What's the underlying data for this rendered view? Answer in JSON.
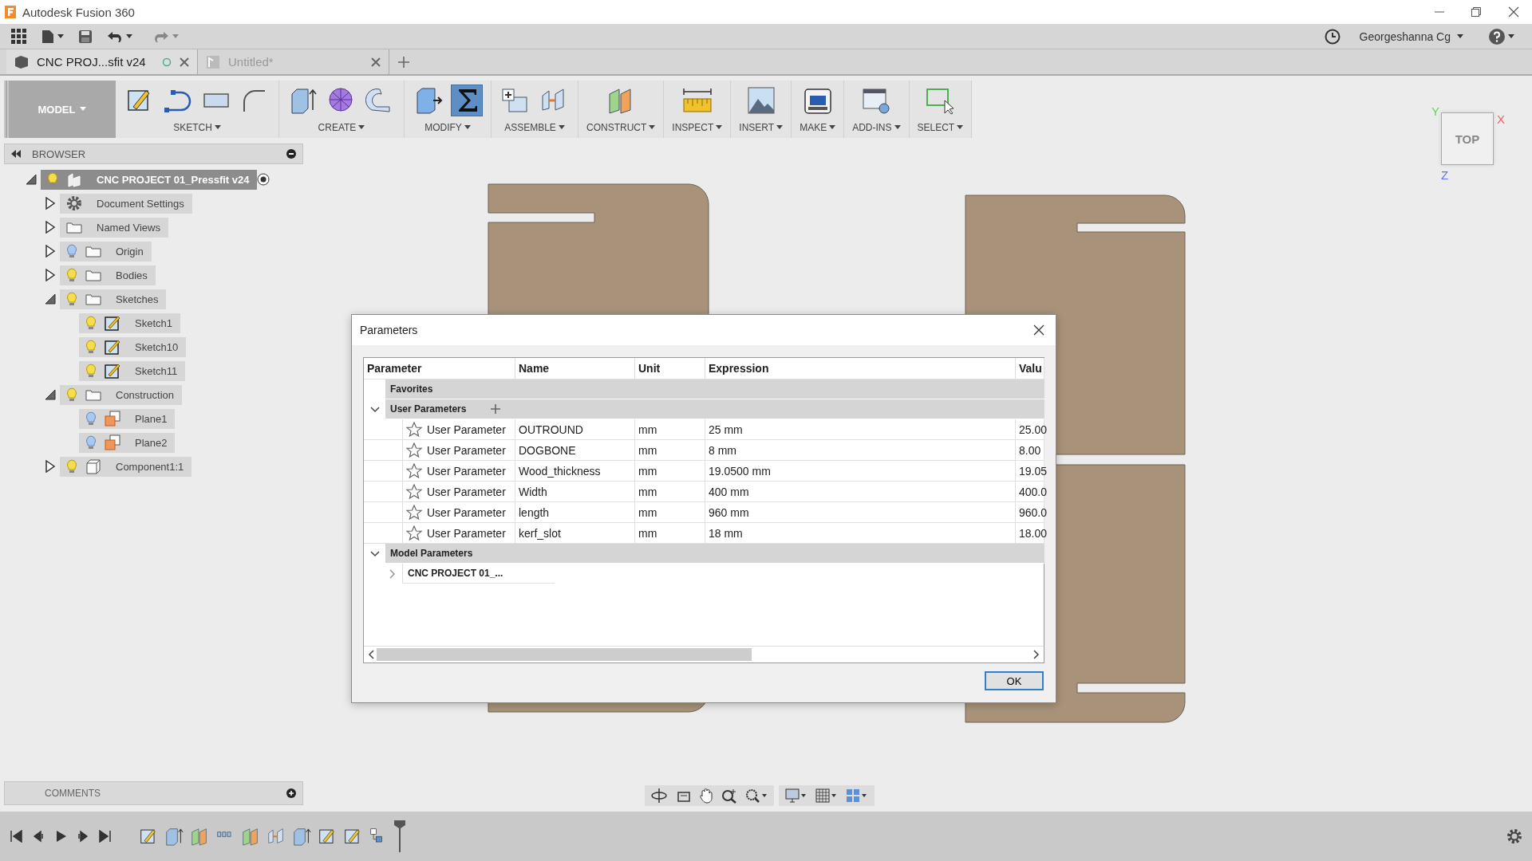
{
  "window": {
    "title": "Autodesk Fusion 360"
  },
  "account": {
    "user": "Georgeshanna Cg"
  },
  "tabs": [
    {
      "label": "CNC PROJ...sfit v24",
      "selected": true
    },
    {
      "label": "Untitled*",
      "selected": false
    }
  ],
  "workspace": {
    "label": "MODEL"
  },
  "ribbon": [
    {
      "label": "SKETCH",
      "tools": [
        {
          "kind": "sketch",
          "selected": false
        },
        {
          "kind": "line",
          "selected": false
        },
        {
          "kind": "rectangle",
          "selected": false
        },
        {
          "kind": "arc",
          "selected": false
        }
      ]
    },
    {
      "label": "CREATE",
      "tools": [
        {
          "kind": "extrude",
          "selected": false
        },
        {
          "kind": "form",
          "selected": false
        },
        {
          "kind": "revolve",
          "selected": false
        }
      ]
    },
    {
      "label": "MODIFY",
      "tools": [
        {
          "kind": "pressmove",
          "selected": false
        },
        {
          "kind": "parameters",
          "selected": true
        }
      ]
    },
    {
      "label": "ASSEMBLE",
      "tools": [
        {
          "kind": "component",
          "selected": false
        },
        {
          "kind": "joint",
          "selected": false
        }
      ]
    },
    {
      "label": "CONSTRUCT",
      "tools": [
        {
          "kind": "plane",
          "selected": false
        }
      ]
    },
    {
      "label": "INSPECT",
      "tools": [
        {
          "kind": "measure",
          "selected": false
        }
      ]
    },
    {
      "label": "INSERT",
      "tools": [
        {
          "kind": "image",
          "selected": false
        }
      ]
    },
    {
      "label": "MAKE",
      "tools": [
        {
          "kind": "print",
          "selected": false
        }
      ]
    },
    {
      "label": "ADD-INS",
      "tools": [
        {
          "kind": "script",
          "selected": false
        }
      ]
    },
    {
      "label": "SELECT",
      "tools": [
        {
          "kind": "select",
          "selected": false
        }
      ]
    }
  ],
  "browser": {
    "title": "BROWSER",
    "tree": [
      {
        "label": "CNC PROJECT 01_Pressfit v24",
        "kind": "root",
        "selected": true,
        "visible": true,
        "expanded": true,
        "children": [
          {
            "label": "Document Settings",
            "kind": "settings",
            "selected": false,
            "expanded": false
          },
          {
            "label": "Named Views",
            "kind": "folder",
            "selected": false,
            "expanded": false
          },
          {
            "label": "Origin",
            "kind": "folder",
            "selected": false,
            "visible": false,
            "expanded": false
          },
          {
            "label": "Bodies",
            "kind": "folder",
            "selected": false,
            "visible": true,
            "expanded": false
          },
          {
            "label": "Sketches",
            "kind": "folder",
            "selected": false,
            "visible": true,
            "expanded": true,
            "children": [
              {
                "label": "Sketch1",
                "kind": "sketch",
                "selected": false,
                "visible": true
              },
              {
                "label": "Sketch10",
                "kind": "sketch",
                "selected": false,
                "visible": true
              },
              {
                "label": "Sketch11",
                "kind": "sketch",
                "selected": false,
                "visible": true
              }
            ]
          },
          {
            "label": "Construction",
            "kind": "folder",
            "selected": false,
            "visible": true,
            "expanded": true,
            "children": [
              {
                "label": "Plane1",
                "kind": "plane",
                "selected": false,
                "visible": false
              },
              {
                "label": "Plane2",
                "kind": "plane",
                "selected": false,
                "visible": false
              }
            ]
          },
          {
            "label": "Component1:1",
            "kind": "component",
            "selected": false,
            "visible": true,
            "expanded": false
          }
        ]
      }
    ]
  },
  "comments": {
    "title": "COMMENTS"
  },
  "viewcube": {
    "face": "TOP",
    "axes": [
      {
        "label": "Y",
        "color": "#5fd35f"
      },
      {
        "label": "X",
        "color": "#f06060"
      },
      {
        "label": "Z",
        "color": "#6a6af0"
      }
    ]
  },
  "dialog": {
    "title": "Parameters",
    "columns": [
      "Parameter",
      "Name",
      "Unit",
      "Expression",
      "Valu"
    ],
    "groups": [
      {
        "kind": "favorites",
        "label": "Favorites"
      },
      {
        "kind": "user",
        "label": "User Parameters",
        "expanded": true,
        "rows": [
          {
            "parameter": "User Parameter",
            "name": "OUTROUND",
            "unit": "mm",
            "expression": "25 mm",
            "value": "25.00",
            "favorite": false
          },
          {
            "parameter": "User Parameter",
            "name": "DOGBONE",
            "unit": "mm",
            "expression": "8 mm",
            "value": "8.00",
            "favorite": false
          },
          {
            "parameter": "User Parameter",
            "name": "Wood_thickness",
            "unit": "mm",
            "expression": "19.0500 mm",
            "value": "19.05",
            "favorite": false
          },
          {
            "parameter": "User Parameter",
            "name": "Width",
            "unit": "mm",
            "expression": "400 mm",
            "value": "400.0",
            "favorite": false
          },
          {
            "parameter": "User Parameter",
            "name": "length",
            "unit": "mm",
            "expression": "960 mm",
            "value": "960.0",
            "favorite": false
          },
          {
            "parameter": "User Parameter",
            "name": "kerf_slot",
            "unit": "mm",
            "expression": "18 mm",
            "value": "18.00",
            "favorite": false
          }
        ]
      },
      {
        "kind": "model",
        "label": "Model Parameters",
        "expanded": true,
        "children": [
          {
            "label": "CNC PROJECT 01_...",
            "expanded": false
          }
        ]
      }
    ],
    "ok_button": "OK"
  }
}
